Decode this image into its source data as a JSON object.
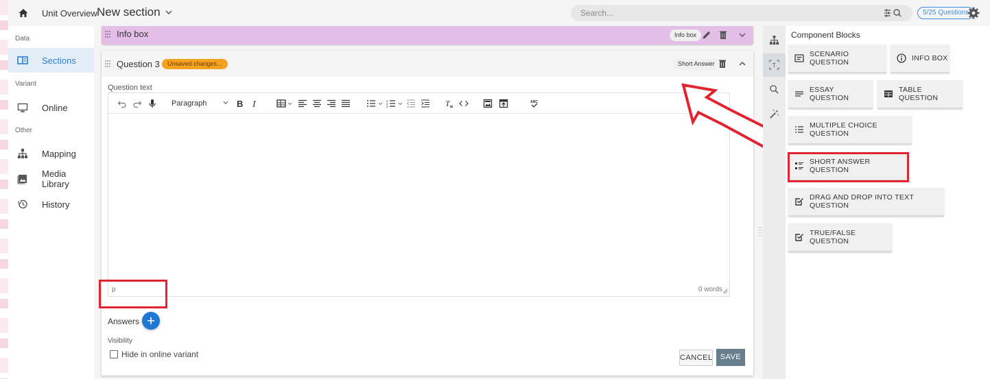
{
  "topbar": {
    "unit_overview": "Unit Overview",
    "section_title": "New section",
    "search_placeholder": "Search...",
    "questions_count": "5/25 Questions"
  },
  "sidebar": {
    "groups": {
      "data": "Data",
      "variant": "Variant",
      "other": "Other"
    },
    "items": [
      {
        "label": "Sections",
        "icon": "sections-icon",
        "active": true
      },
      {
        "label": "Online",
        "icon": "monitor-icon"
      },
      {
        "label": "Mapping",
        "icon": "hierarchy-icon"
      },
      {
        "label": "Media Library",
        "icon": "image-icon"
      },
      {
        "label": "History",
        "icon": "history-icon"
      }
    ]
  },
  "infobox": {
    "title": "Info box",
    "chip": "Info box"
  },
  "question": {
    "title": "Question 3",
    "unsaved": "Unsaved changes...",
    "type_chip": "Short Answer",
    "text_label": "Question text",
    "paragraph_select": "Paragraph",
    "status_path": "p",
    "word_count": "0 words",
    "answers_label": "Answers",
    "visibility_label": "Visibility",
    "hide_label": "Hide in online variant",
    "hide_checked": false,
    "cancel": "CANCEL",
    "save": "SAVE"
  },
  "blocks": {
    "title": "Component Blocks",
    "items": [
      {
        "label": "SCENARIO QUESTION",
        "icon": "scenario-icon"
      },
      {
        "label": "INFO BOX",
        "icon": "info-icon"
      },
      {
        "label": "ESSAY QUESTION",
        "icon": "lines-icon"
      },
      {
        "label": "TABLE QUESTION",
        "icon": "table-icon"
      },
      {
        "label": "MULTIPLE CHOICE QUESTION",
        "icon": "list-icon"
      },
      {
        "label": "SHORT ANSWER QUESTION",
        "icon": "short-answer-icon"
      },
      {
        "label": "DRAG AND DROP INTO TEXT QUESTION",
        "icon": "checkbox-icon"
      },
      {
        "label": "TRUE/FALSE QUESTION",
        "icon": "checkbox-icon"
      }
    ]
  },
  "colors": {
    "accent": "#2f7fd0",
    "infobox_bg": "#e3bfe8",
    "unsaved_bg": "#f4a21f",
    "highlight_red": "#e02430",
    "save_bg": "#667e8e"
  }
}
